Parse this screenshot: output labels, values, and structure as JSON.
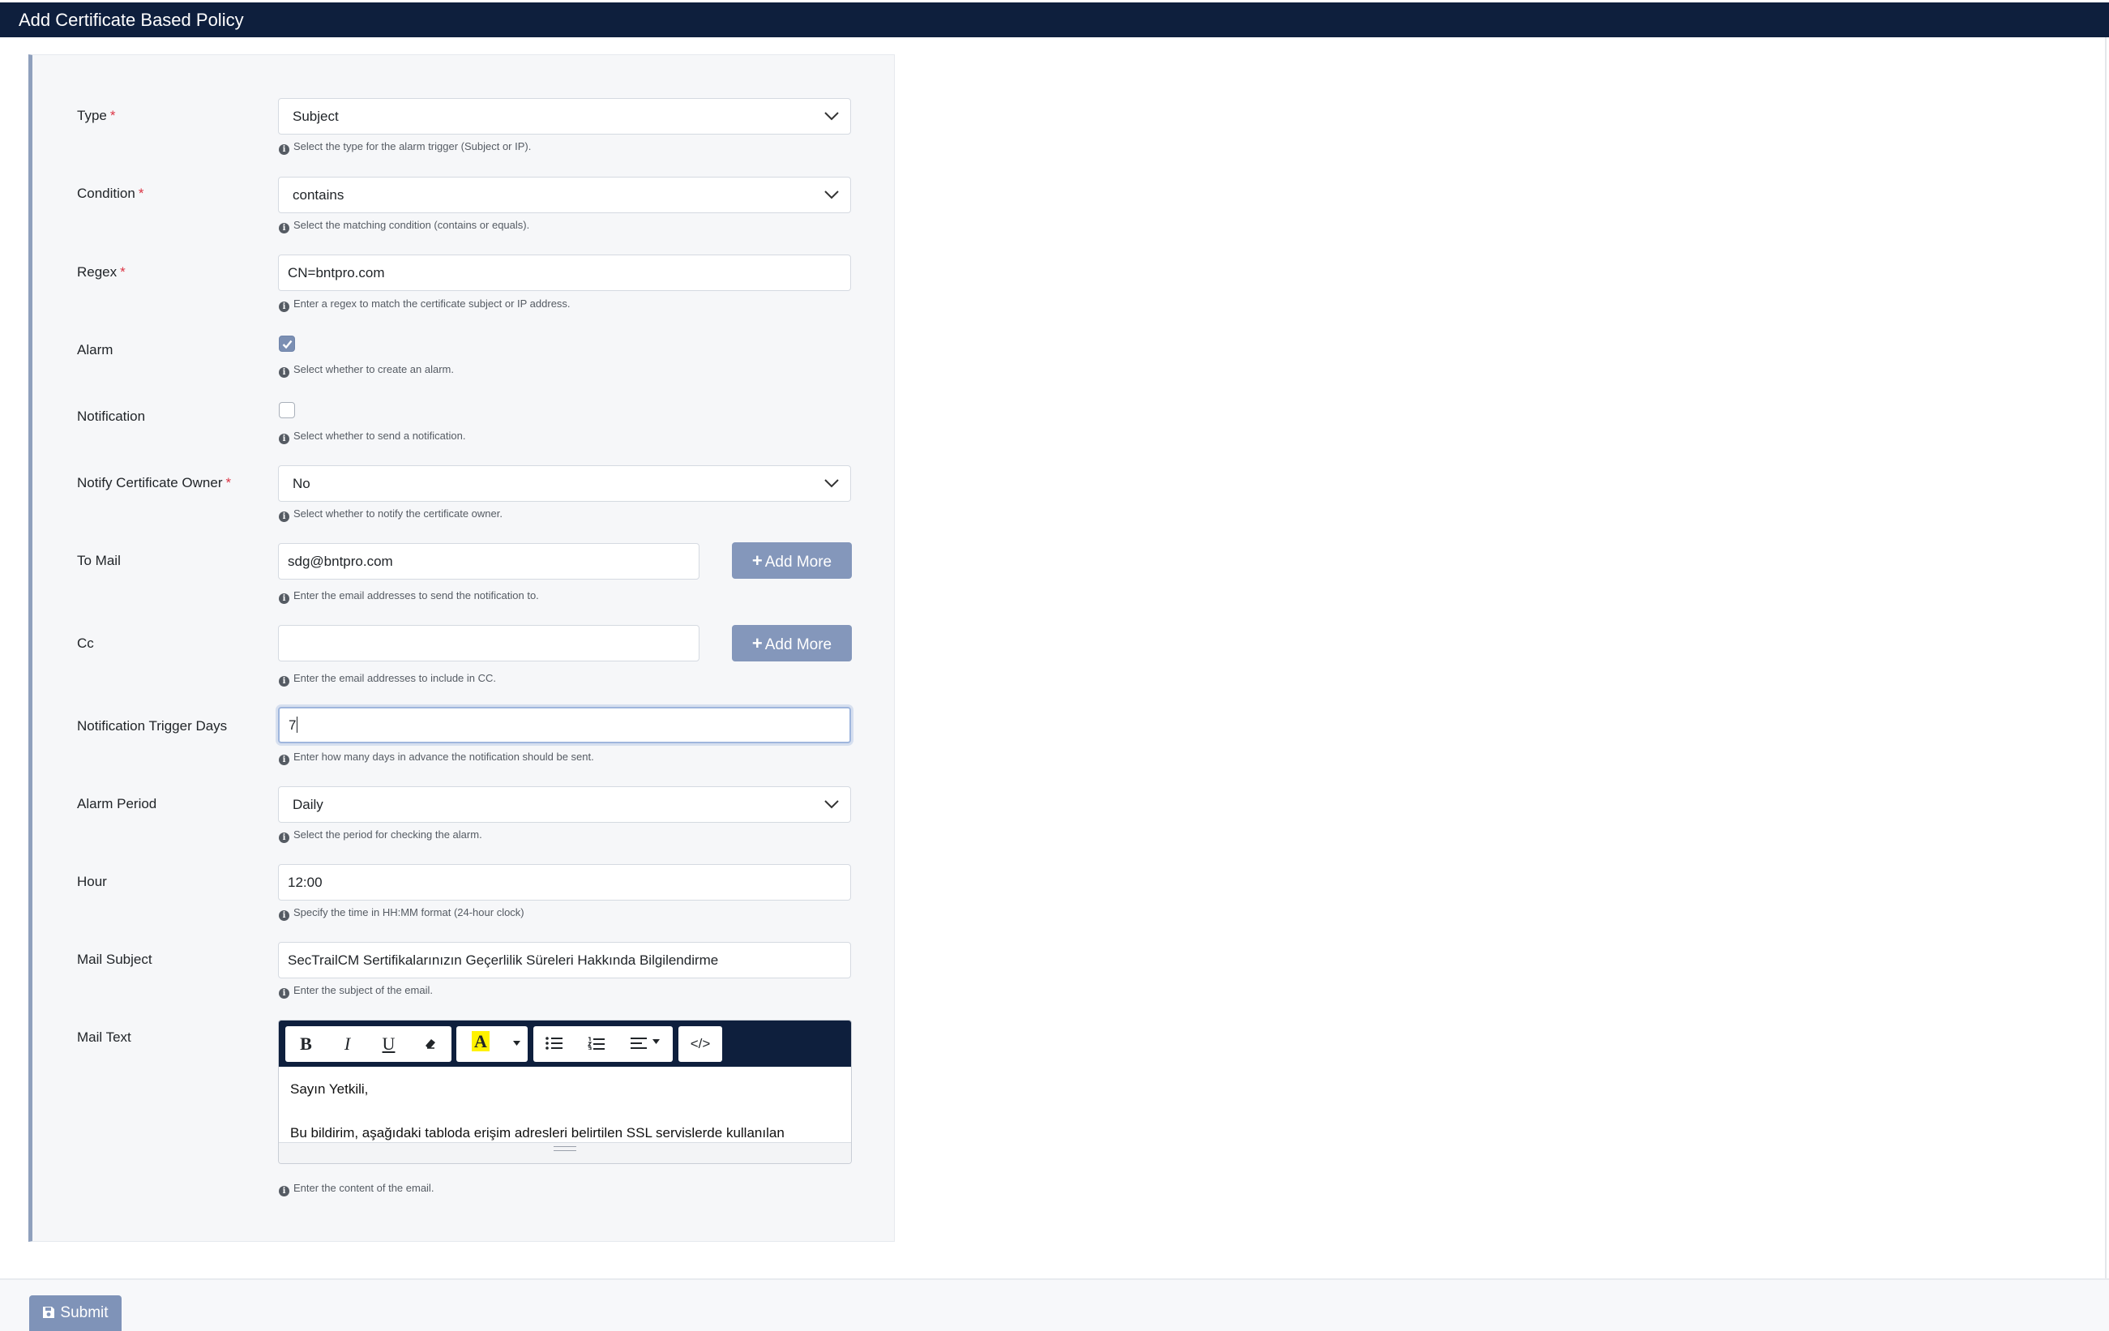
{
  "page": {
    "title": "Add Certificate Based Policy"
  },
  "form": {
    "type": {
      "label": "Type",
      "required": "*",
      "value": "Subject",
      "help": "Select the type for the alarm trigger (Subject or IP)."
    },
    "condition": {
      "label": "Condition",
      "required": "*",
      "value": "contains",
      "help": "Select the matching condition (contains or equals)."
    },
    "regex": {
      "label": "Regex",
      "required": "*",
      "value": "CN=bntpro.com",
      "help": "Enter a regex to match the certificate subject or IP address."
    },
    "alarm": {
      "label": "Alarm",
      "checked": true,
      "help": "Select whether to create an alarm."
    },
    "notification": {
      "label": "Notification",
      "checked": false,
      "help": "Select whether to send a notification."
    },
    "notify_owner": {
      "label": "Notify Certificate Owner",
      "required": "*",
      "value": "No",
      "help": "Select whether to notify the certificate owner."
    },
    "to_mail": {
      "label": "To Mail",
      "value": "sdg@bntpro.com",
      "help": "Enter the email addresses to send the notification to.",
      "add_label": "Add More"
    },
    "cc": {
      "label": "Cc",
      "value": "",
      "help": "Enter the email addresses to include in CC.",
      "add_label": "Add More"
    },
    "trigger_days": {
      "label": "Notification Trigger Days",
      "value": "7",
      "help": "Enter how many days in advance the notification should be sent."
    },
    "alarm_period": {
      "label": "Alarm Period",
      "value": "Daily",
      "help": "Select the period for checking the alarm."
    },
    "hour": {
      "label": "Hour",
      "value": "12:00",
      "help": "Specify the time in HH:MM format (24-hour clock)"
    },
    "mail_subject": {
      "label": "Mail Subject",
      "value": "SecTrailCM Sertifikalarınızın Geçerlilik Süreleri Hakkında Bilgilendirme",
      "help": "Enter the subject of the email."
    },
    "mail_text": {
      "label": "Mail Text",
      "paragraphs": [
        "Sayın Yetkili,",
        "Bu bildirim, aşağıdaki tabloda erişim adresleri belirtilen SSL servislerde kullanılan"
      ],
      "help": "Enter the content of the email.",
      "toolbar": {
        "bold": "B",
        "italic": "I",
        "underline": "U",
        "highlight": "A",
        "code": "</>"
      }
    }
  },
  "actions": {
    "submit_label": "Submit"
  },
  "colors": {
    "header": "#0e1f3d",
    "accent": "#8497bb",
    "required": "#dc3545",
    "panel_border": "#8fa0bd"
  }
}
